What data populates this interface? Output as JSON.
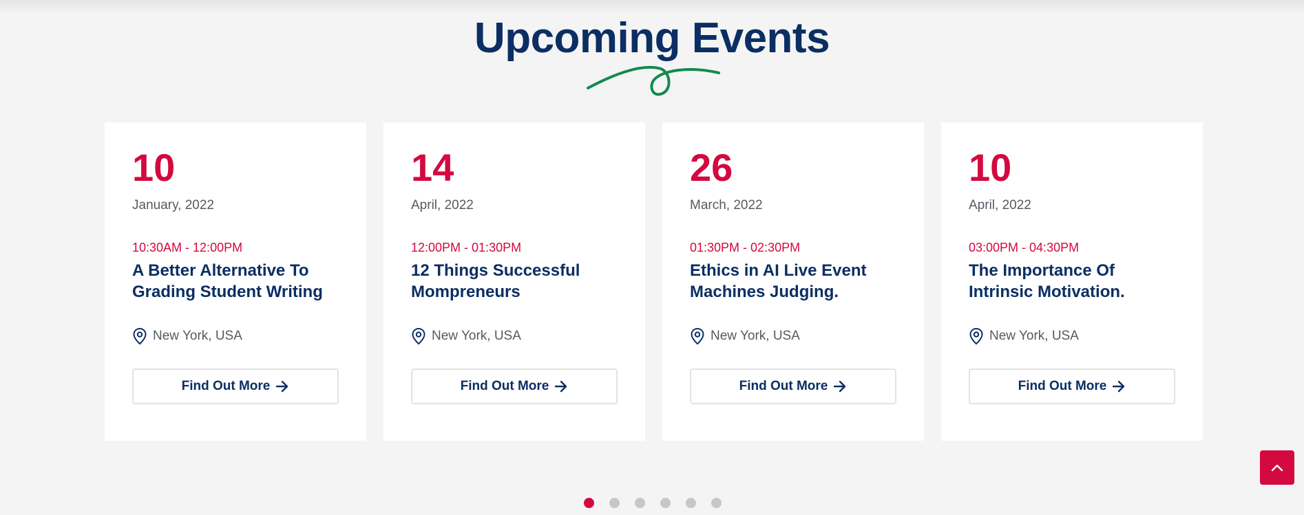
{
  "section": {
    "title": "Upcoming Events"
  },
  "events": [
    {
      "day": "10",
      "month": "January, 2022",
      "time": "10:30AM - 12:00PM",
      "title": "A Better Alternative To Grading Student Writing",
      "location": "New York, USA",
      "button_label": "Find Out More"
    },
    {
      "day": "14",
      "month": "April, 2022",
      "time": "12:00PM - 01:30PM",
      "title": "12 Things Successful Mompreneurs",
      "location": "New York, USA",
      "button_label": "Find Out More"
    },
    {
      "day": "26",
      "month": "March, 2022",
      "time": "01:30PM - 02:30PM",
      "title": "Ethics in AI Live Event Machines Judging.",
      "location": "New York, USA",
      "button_label": "Find Out More"
    },
    {
      "day": "10",
      "month": "April, 2022",
      "time": "03:00PM - 04:30PM",
      "title": "The Importance Of Intrinsic Motivation.",
      "location": "New York, USA",
      "button_label": "Find Out More"
    }
  ],
  "pagination": {
    "total_pages": 6,
    "active_page": 1
  },
  "icons": {
    "location": "map-pin-icon",
    "button_arrow": "arrow-right-icon",
    "back_to_top": "chevron-up-icon",
    "title_decoration": "squiggle-underline"
  },
  "colors": {
    "primary_navy": "#0b2e63",
    "accent_red": "#d3093f",
    "accent_green": "#138a4e",
    "background": "#f4f4f4",
    "card_background": "#ffffff",
    "muted_text": "#555a62",
    "inactive_dot": "#c7c7c7"
  }
}
